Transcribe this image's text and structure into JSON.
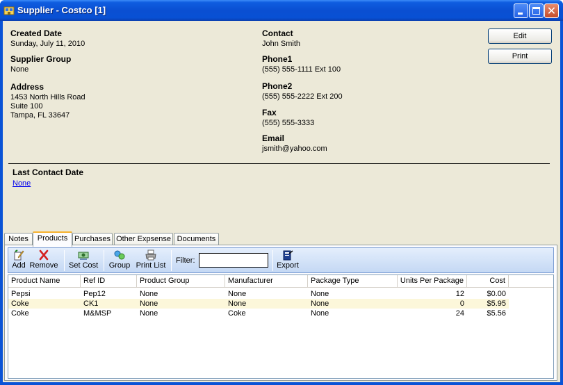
{
  "window": {
    "title": "Supplier - Costco [1]"
  },
  "details": {
    "created_date_label": "Created Date",
    "created_date": "Sunday, July 11, 2010",
    "supplier_group_label": "Supplier Group",
    "supplier_group": "None",
    "address_label": "Address",
    "address_line1": "1453 North Hills Road",
    "address_line2": "Suite 100",
    "address_line3": "Tampa, FL 33647",
    "contact_label": "Contact",
    "contact": "John Smith",
    "phone1_label": "Phone1",
    "phone1": "(555) 555-1111  Ext 100",
    "phone2_label": "Phone2",
    "phone2": "(555) 555-2222  Ext 200",
    "fax_label": "Fax",
    "fax": "(555) 555-3333",
    "email_label": "Email",
    "email": "jsmith@yahoo.com",
    "last_contact_label": "Last Contact Date",
    "last_contact": "None"
  },
  "actions": {
    "edit": "Edit",
    "print": "Print"
  },
  "tabs": [
    "Notes",
    "Products",
    "Purchases",
    "Other Expsense",
    "Documents"
  ],
  "active_tab": "Products",
  "toolbar": {
    "add": "Add",
    "remove": "Remove",
    "set_cost": "Set Cost",
    "group": "Group",
    "print_list": "Print List",
    "filter_label": "Filter:",
    "filter_value": "",
    "export": "Export"
  },
  "grid": {
    "columns": [
      "Product Name",
      "Ref ID",
      "Product Group",
      "Manufacturer",
      "Package Type",
      "Units Per Package",
      "Cost"
    ],
    "rows": [
      [
        "Pepsi",
        "Pep12",
        "None",
        "None",
        "None",
        "12",
        "$0.00"
      ],
      [
        "Coke",
        "CK1",
        "None",
        "None",
        "None",
        "0",
        "$5.95"
      ],
      [
        "Coke",
        "M&MSP",
        "None",
        "Coke",
        "None",
        "24",
        "$5.56"
      ]
    ]
  },
  "colors": {
    "titlebar": "#0A53D6",
    "client_bg": "#ECE9D8",
    "toolbar_bg": "#C4D8F4",
    "link": "#0000EE",
    "active_tab_accent": "#F7B22E",
    "alt_row": "#FCF7DA"
  }
}
